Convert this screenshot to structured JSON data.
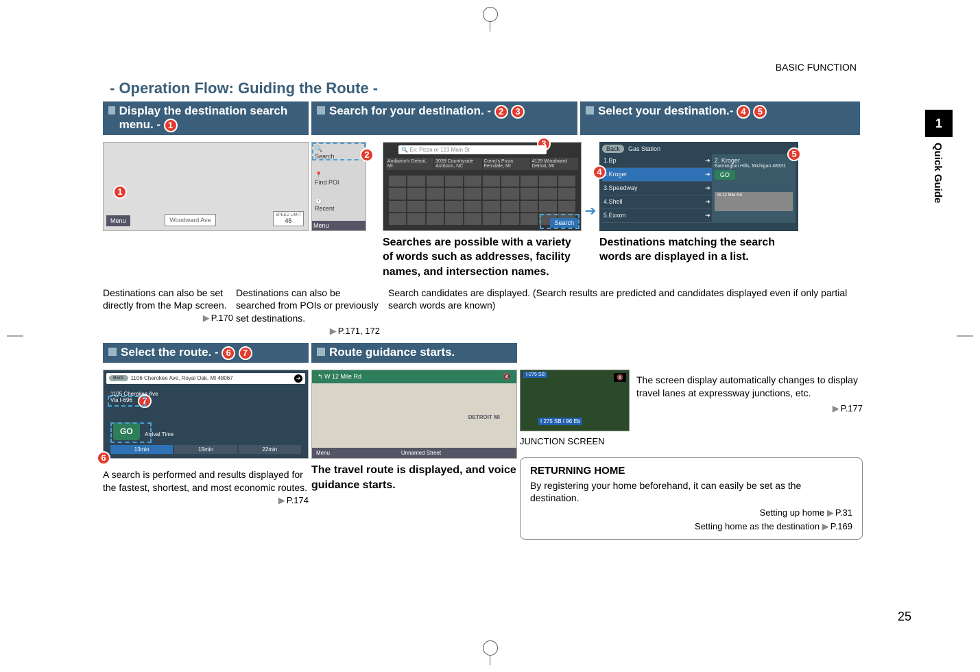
{
  "breadcrumb": "BASIC FUNCTION",
  "side_tab": {
    "chapter": "1",
    "label": "Quick Guide"
  },
  "page_number": "25",
  "section_title": "- Operation Flow: Guiding the Route -",
  "steps": {
    "s1": {
      "title": "Display the destination search menu. -"
    },
    "s2": {
      "title": "Search for your destination. -"
    },
    "s3": {
      "title": "Select your destination.-"
    },
    "s4": {
      "title": "Select the route. -"
    },
    "s5": {
      "title": "Route guidance starts."
    }
  },
  "map1": {
    "woodward": "Woodward Ave",
    "speed_label": "SPEED\nLIMIT",
    "speed_value": "45",
    "menu": "Menu"
  },
  "strip": {
    "search": "Search",
    "find": "Find POI",
    "recent": "Recent",
    "menu": "Menu"
  },
  "caption1a": "Destinations can also be set directly from the Map screen.",
  "caption1a_ref": "P.170",
  "caption1b": "Destinations can also be searched from POIs or previously set destinations.",
  "caption1b_ref": "P.171, 172",
  "kbd": {
    "placeholder": "Ex: Pizza or 123 Main St",
    "search_btn": "Search",
    "sug1": "Andiamo's Detroit, MI",
    "sug2": "3039 Countryside Ashboro, NC",
    "sug3": "Como's Pizza Ferndale, MI",
    "sug4": "4129 Woodward Detroit, MI"
  },
  "caption2_bold": "Searches are possible with a variety of words such as addresses, facility names, and intersection names.",
  "caption2_sub": "Search candidates are displayed. (Search results are predicted and candidates displayed even if only partial search words are known)",
  "list": {
    "back": "Back",
    "title": "Gas Station",
    "items": [
      "1.Bp",
      "2.Kroger",
      "3.Speedway",
      "4.Shell",
      "5.Exxon"
    ],
    "detail_name": "2. Kroger",
    "detail_addr": "Farmington Hills, Michigan 48331",
    "go": "GO",
    "street1": "W 12 Mile Rd",
    "street2": "W 12 Mile Rd"
  },
  "caption3_bold": "Destinations matching the search words are displayed in a list.",
  "route": {
    "back": "Back",
    "addr": "1106 Cherokee Ave, Royal Oak, MI 48067",
    "via": "Via I-696",
    "go": "GO",
    "type": "Arrival Time",
    "t1": "13min",
    "t2": "15min",
    "t3": "22min"
  },
  "caption4": "A search is performed and results displayed for the fastest, shortest, and most economic routes.",
  "caption4_ref": "P.174",
  "guidance": {
    "street_top": "W 12 Mile Rd",
    "street_bottom": "Unnamed Street",
    "menu": "Menu",
    "city": "DETROIT MI"
  },
  "caption5_bold": "The travel route is displayed, and voice guidance starts.",
  "junction": {
    "label": "JUNCTION SCREEN",
    "hwy_top": "I-275 SB",
    "hwy_bottom": "I 275 SB I 96 Eb",
    "text": "The screen display automatically changes to display travel lanes at expressway junctions, etc.",
    "ref": "P.177"
  },
  "returning": {
    "title": "RETURNING HOME",
    "body": "By registering your home beforehand, it can easily be set as the destination.",
    "l1": "Setting up home",
    "l1_ref": "P.31",
    "l2": "Setting home as the destination",
    "l2_ref": "P.169"
  },
  "tri": "▶"
}
